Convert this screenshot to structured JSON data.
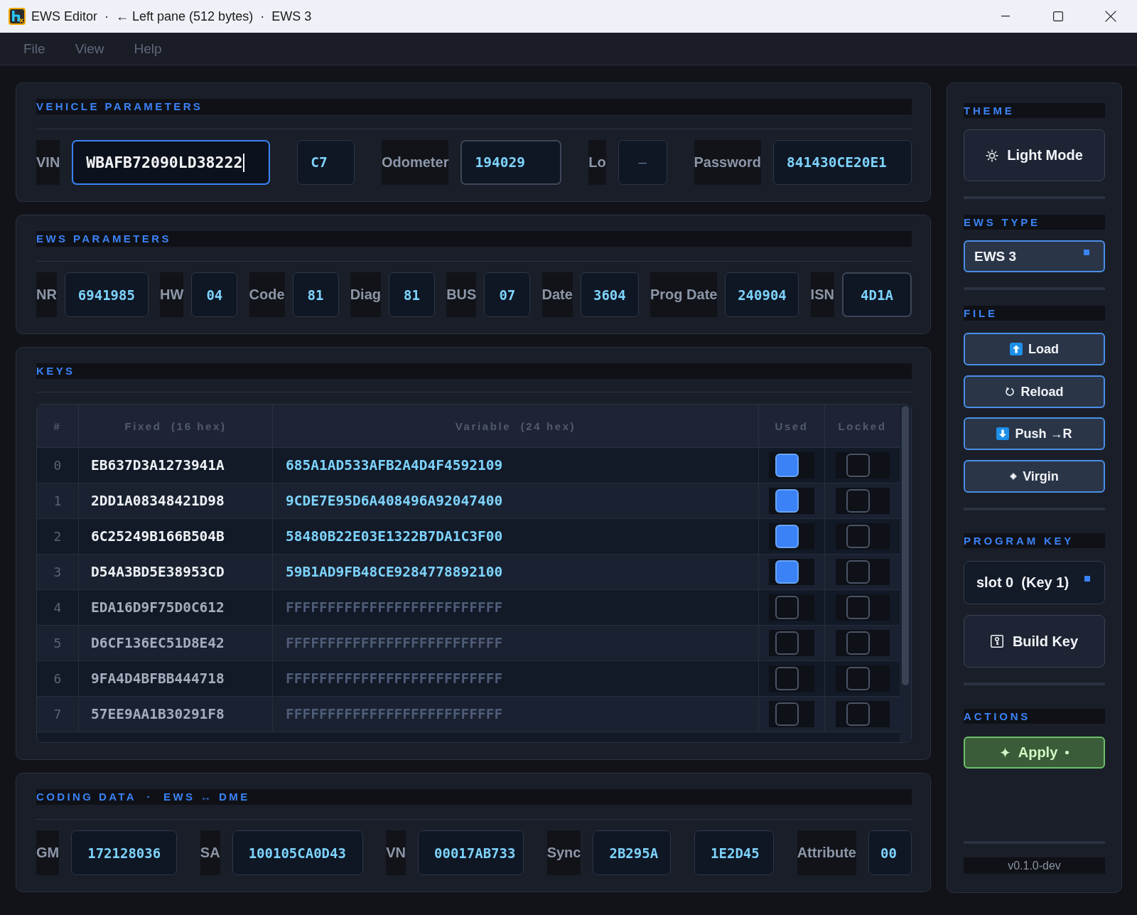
{
  "window": {
    "title": "EWS Editor  ·  ← Left pane (512 bytes)  ·  EWS 3"
  },
  "menu": [
    "File",
    "View",
    "Help"
  ],
  "vehicle_parameters": {
    "title": "VEHICLE PARAMETERS",
    "fields": [
      {
        "label": "VIN",
        "value": "WBAFB72090LD38222",
        "focused": true,
        "highlighted": false
      },
      {
        "value": "C7",
        "focused": false,
        "highlighted": false
      },
      {
        "label": "Odometer",
        "value": "194029",
        "focused": false,
        "highlighted": true
      },
      {
        "label": "Lo",
        "placeholder": "–",
        "focused": false,
        "highlighted": false
      },
      {
        "label": "Password",
        "value": "841430CE20E1",
        "focused": false,
        "highlighted": false
      }
    ]
  },
  "ews_parameters": {
    "title": "EWS PARAMETERS",
    "fields": [
      {
        "label": "NR",
        "value": "6941985",
        "highlighted": false
      },
      {
        "label": "HW",
        "value": "04",
        "highlighted": false
      },
      {
        "label": "Code",
        "value": "81",
        "highlighted": false
      },
      {
        "label": "Diag",
        "value": "81",
        "highlighted": false
      },
      {
        "label": "BUS",
        "value": "07",
        "highlighted": false
      },
      {
        "label": "Date",
        "value": "3604",
        "highlighted": false
      },
      {
        "label": "Prog Date",
        "value": "240904",
        "highlighted": false
      },
      {
        "label": "ISN",
        "value": "4D1A",
        "highlighted": true
      }
    ]
  },
  "keys": {
    "title": "KEYS",
    "columns": [
      "#",
      "Fixed  (16 hex)",
      "Variable  (24 hex)",
      "Used",
      "Locked"
    ],
    "rows": [
      {
        "index": "0",
        "fixed": "EB637D3A1273941A",
        "variable": "685A1AD533AFB2A4D4F4592109",
        "used": true,
        "locked": false
      },
      {
        "index": "1",
        "fixed": "2DD1A08348421D98",
        "variable": "9CDE7E95D6A408496A92047400",
        "used": true,
        "locked": false
      },
      {
        "index": "2",
        "fixed": "6C25249B166B504B",
        "variable": "58480B22E03E1322B7DA1C3F00",
        "used": true,
        "locked": false
      },
      {
        "index": "3",
        "fixed": "D54A3BD5E38953CD",
        "variable": "59B1AD9FB48CE9284778892100",
        "used": true,
        "locked": false
      },
      {
        "index": "4",
        "fixed": "EDA16D9F75D0C612",
        "variable": "FFFFFFFFFFFFFFFFFFFFFFFFFF",
        "used": false,
        "locked": false
      },
      {
        "index": "5",
        "fixed": "D6CF136EC51D8E42",
        "variable": "FFFFFFFFFFFFFFFFFFFFFFFFFF",
        "used": false,
        "locked": false
      },
      {
        "index": "6",
        "fixed": "9FA4D4BFBB444718",
        "variable": "FFFFFFFFFFFFFFFFFFFFFFFFFF",
        "used": false,
        "locked": false
      },
      {
        "index": "7",
        "fixed": "57EE9AA1B30291F8",
        "variable": "FFFFFFFFFFFFFFFFFFFFFFFFFF",
        "used": false,
        "locked": false
      }
    ]
  },
  "coding_data": {
    "title": "CODING DATA  ·  EWS ↔ DME",
    "fields": [
      {
        "label": "GM",
        "value": "172128036"
      },
      {
        "label": "SA",
        "value": "100105CA0D43"
      },
      {
        "label": "VN",
        "value": "00017AB733"
      },
      {
        "label": "Sync",
        "value": "2B295A"
      },
      {
        "value": "1E2D45"
      },
      {
        "label": "Attribute",
        "value": "00"
      }
    ]
  },
  "sidebar": {
    "theme": {
      "title": "THEME",
      "button": "Light Mode"
    },
    "ews_type": {
      "title": "EWS TYPE",
      "value": "EWS 3"
    },
    "file": {
      "title": "FILE",
      "buttons": [
        "Load",
        "Reload",
        "Push →R",
        "Virgin"
      ]
    },
    "program_key": {
      "title": "PROGRAM KEY",
      "value": "slot 0  (Key 1)",
      "button": "Build Key"
    },
    "actions": {
      "title": "ACTIONS",
      "button": "Apply"
    },
    "version": "v0.1.0-dev"
  }
}
